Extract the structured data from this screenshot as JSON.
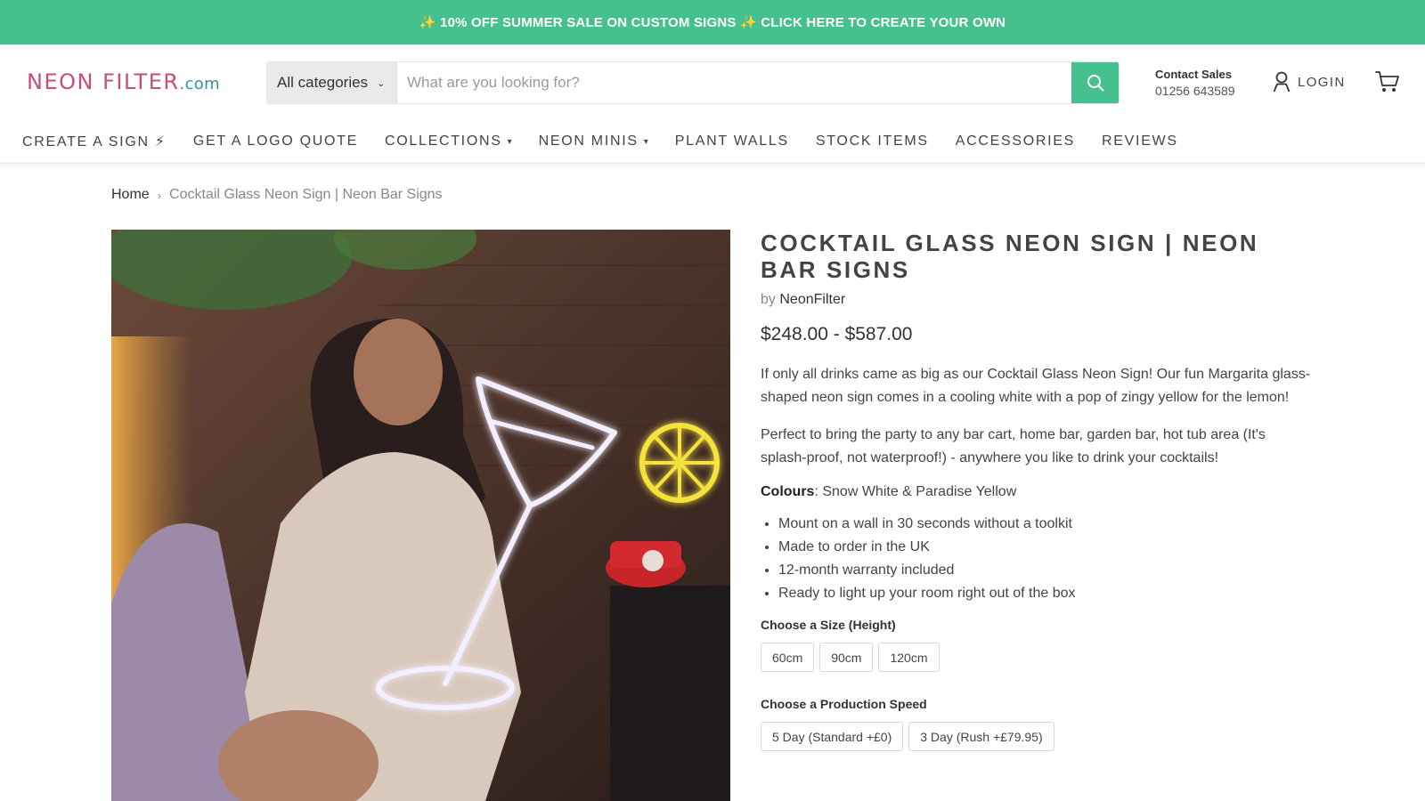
{
  "announcement": "✨ 10% OFF SUMMER SALE ON CUSTOM SIGNS ✨ CLICK HERE TO CREATE YOUR OWN",
  "header": {
    "logo_main": "NEON FILTER",
    "logo_tld": ".com",
    "search": {
      "category": "All categories",
      "placeholder": "What are you looking for?"
    },
    "contact": {
      "title": "Contact Sales",
      "phone": "01256 643589"
    },
    "login_label": "LOGIN"
  },
  "nav": {
    "items": [
      {
        "label": "CREATE A SIGN ⚡"
      },
      {
        "label": "GET A LOGO QUOTE"
      },
      {
        "label": "COLLECTIONS"
      },
      {
        "label": "NEON MINIS"
      },
      {
        "label": "PLANT WALLS"
      },
      {
        "label": "STOCK ITEMS"
      },
      {
        "label": "ACCESSORIES"
      },
      {
        "label": "REVIEWS"
      }
    ]
  },
  "breadcrumb": {
    "home": "Home",
    "current": "Cocktail Glass Neon Sign | Neon Bar Signs"
  },
  "product": {
    "title": "COCKTAIL GLASS NEON SIGN | NEON BAR SIGNS",
    "by_prefix": "by",
    "vendor": "NeonFilter",
    "price": "$248.00 - $587.00",
    "desc1": "If only all drinks came as big as our Cocktail Glass Neon Sign! Our fun Margarita glass-shaped neon sign comes in a cooling white with a pop of zingy yellow for the lemon!",
    "desc2": "Perfect to bring the party to any bar cart, home bar, garden bar, hot tub area (It's splash-proof, not waterproof!) - anywhere you like to drink your cocktails!",
    "colours_label": "Colours",
    "colours_value": ": Snow White & Paradise Yellow",
    "bullets": [
      "Mount on a wall in 30 seconds without a toolkit",
      "Made to order in the UK",
      "12-month warranty included",
      "Ready to light up your room right out of the box"
    ],
    "size_label": "Choose a Size (Height)",
    "sizes": [
      "60cm",
      "90cm",
      "120cm"
    ],
    "speed_label": "Choose a Production Speed",
    "speeds": [
      "5 Day (Standard +£0)",
      "3 Day (Rush +£79.95)"
    ]
  },
  "colors": {
    "accent": "#46c08e",
    "logo_pink": "#c64e78",
    "logo_teal": "#3a8fa0"
  }
}
